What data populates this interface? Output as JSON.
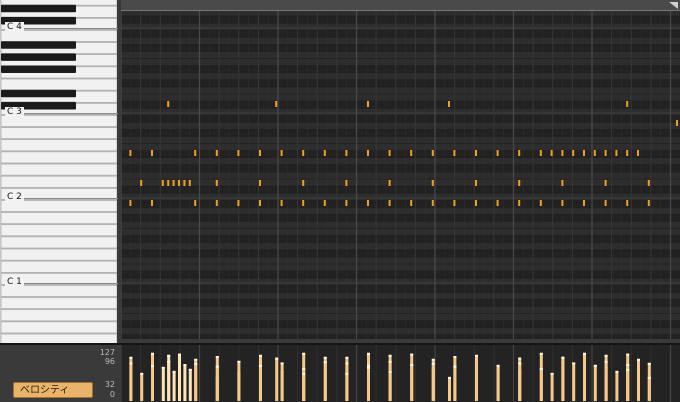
{
  "keyboard": {
    "octave_labels": [
      {
        "text": "C 4",
        "key_index": 0
      },
      {
        "text": "C 3",
        "key_index": 1
      },
      {
        "text": "C 2",
        "key_index": 2
      },
      {
        "text": "C 1",
        "key_index": 3
      }
    ]
  },
  "velocity": {
    "button_label": "ベロシティ",
    "scale_labels": [
      "127",
      "96",
      "32",
      "0"
    ]
  },
  "colors": {
    "note": "#f0a020",
    "velocity_bar": "#f4c98a",
    "velocity_bar_selected": "#ffe4b8",
    "grid_bar": "#4a4a4a",
    "grid_beat": "#363636"
  },
  "notes": {
    "rows": [
      {
        "row": "upper",
        "times": [
          0.08,
          0.28,
          0.45,
          0.6,
          0.93
        ]
      },
      {
        "row": "middle-top",
        "times": []
      },
      {
        "row": "chord-hi",
        "times": [
          0.01,
          0.05,
          0.13,
          0.17,
          0.21,
          0.25,
          0.29,
          0.33,
          0.37,
          0.41,
          0.45,
          0.49,
          0.53,
          0.57,
          0.61,
          0.65,
          0.69,
          0.73,
          0.77,
          0.79,
          0.81,
          0.83,
          0.85,
          0.87,
          0.89,
          0.91,
          0.93,
          0.95
        ]
      },
      {
        "row": "chord-mid",
        "times": [
          0.03,
          0.07,
          0.08,
          0.09,
          0.1,
          0.11,
          0.12,
          0.17,
          0.25,
          0.33,
          0.41,
          0.49,
          0.57,
          0.65,
          0.73,
          0.81,
          0.89,
          0.97
        ]
      },
      {
        "row": "bass",
        "times": [
          0.01,
          0.05,
          0.13,
          0.17,
          0.21,
          0.25,
          0.29,
          0.33,
          0.37,
          0.41,
          0.45,
          0.49,
          0.53,
          0.57,
          0.61,
          0.65,
          0.69,
          0.73,
          0.77,
          0.81,
          0.85,
          0.89,
          0.93,
          0.97
        ]
      }
    ]
  }
}
